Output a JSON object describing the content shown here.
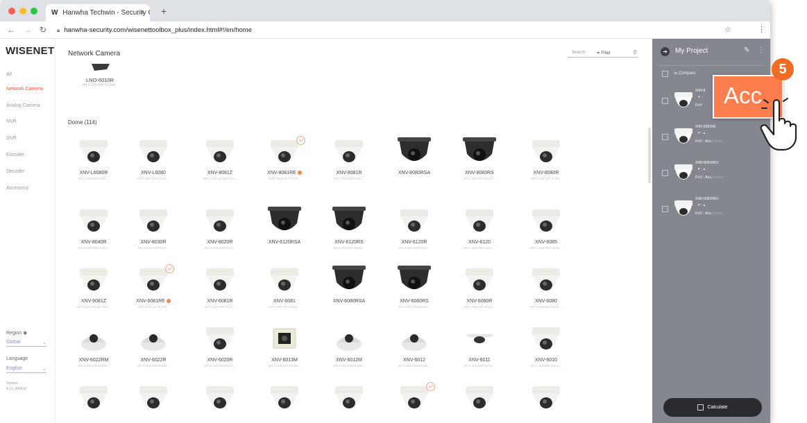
{
  "browser": {
    "tab_title": "Hanwha Techwin - Security Gi",
    "tab_favicon": "W",
    "url": "hanwha-security.com/wisenettoolbox_plus/index.html#!/en/home"
  },
  "sidebar": {
    "logo": "WISENET",
    "items": [
      {
        "label": "All"
      },
      {
        "label": "Network Camera"
      },
      {
        "label": "Analog Camera"
      },
      {
        "label": "NVR"
      },
      {
        "label": "DVR"
      },
      {
        "label": "Encoder"
      },
      {
        "label": "Decoder"
      },
      {
        "label": "Accessory"
      }
    ],
    "region_label": "Region",
    "region_value": "Global",
    "language_label": "Language",
    "language_value": "English",
    "version_label": "Version",
    "version_value": "4.13_200512"
  },
  "main": {
    "title": "Network Camera",
    "filter_label": "Filter",
    "search_placeholder": "Search",
    "top_product": {
      "name": "LNO-6010R",
      "desc": "2M H.264 NW IR Bull..."
    },
    "section_title": "Dome (114)",
    "products": [
      {
        "name": "XNV-L6080R",
        "desc": "2M H.265 NW IR Do...",
        "style": "white"
      },
      {
        "name": "XNV-L6080",
        "desc": "2M H.265 NW Dome ...",
        "style": "white"
      },
      {
        "name": "XNV-8081Z",
        "desc": "5M H.265 Vandal-Resi...",
        "style": "white"
      },
      {
        "name": "XNV-8081RE",
        "desc": "5MP Network IR Poll...",
        "style": "white",
        "badge": true,
        "checked": true
      },
      {
        "name": "XNV-8081R",
        "desc": "5M H.265 NW IR Do...",
        "style": "white"
      },
      {
        "name": "XNV-8080RSA",
        "desc": "",
        "style": "black"
      },
      {
        "name": "XNV-8080RS",
        "desc": "5M H.265 NW Stainle...",
        "style": "black"
      },
      {
        "name": "XNV-8080R",
        "desc": "5M H.265 NW IR Do...",
        "style": "white"
      },
      {
        "name": "XNV-8040R",
        "desc": "5M H.265 NW IR Do...",
        "style": "white"
      },
      {
        "name": "XNV-8030R",
        "desc": "5M H.265 NW IR Do...",
        "style": "white"
      },
      {
        "name": "XNV-8020R",
        "desc": "5M H.265 NW IR Do...",
        "style": "white"
      },
      {
        "name": "XNV-6120RSA",
        "desc": "",
        "style": "black"
      },
      {
        "name": "XNV-6120RS",
        "desc": "2M H.265 NW Stainle...",
        "style": "black"
      },
      {
        "name": "XNV-6120R",
        "desc": "2M H.265 NW IR Do...",
        "style": "white"
      },
      {
        "name": "XNV-6120",
        "desc": "2M H.265 NW Dome ...",
        "style": "white"
      },
      {
        "name": "XNV-6085",
        "desc": "2M H.265 NW Camer...",
        "style": "white"
      },
      {
        "name": "XNV-6081Z",
        "desc": "2M H.265 Vandal-Resi...",
        "style": "white"
      },
      {
        "name": "XNV-6081RE",
        "desc": "2MP Network IR Poll...",
        "style": "white",
        "badge": true,
        "checked": true
      },
      {
        "name": "XNV-6081R",
        "desc": "2M H.265 NW IR Do...",
        "style": "white"
      },
      {
        "name": "XNV-6081",
        "desc": "2M H.265 NW Dome ...",
        "style": "white"
      },
      {
        "name": "XNV-6080RSA",
        "desc": "",
        "style": "black"
      },
      {
        "name": "XNV-6080RS",
        "desc": "2M H.265 NW Stainle...",
        "style": "black"
      },
      {
        "name": "XNV-6080R",
        "desc": "2M H.265 NW IR Do...",
        "style": "white"
      },
      {
        "name": "XNV-6080",
        "desc": "2M H.265 NW Dome ...",
        "style": "white"
      },
      {
        "name": "XNV-6022RM",
        "desc": "2M H.265 NW Mobile...",
        "style": "flat"
      },
      {
        "name": "XNV-6022R",
        "desc": "2M H.265 NW Mobile...",
        "style": "flat"
      },
      {
        "name": "XNV-6020R",
        "desc": "2M H.265 NW IR Do...",
        "style": "white"
      },
      {
        "name": "XNV-6013M",
        "desc": "2M H.265 NW Mobile...",
        "style": "box"
      },
      {
        "name": "XNV-6012M",
        "desc": "2M H.265 NW Mobile...",
        "style": "flat"
      },
      {
        "name": "XNV-6012",
        "desc": "2M H.265 NW Mobile...",
        "style": "flat"
      },
      {
        "name": "XNV-6011",
        "desc": "2M H.265 NW Dome ...",
        "style": "mini"
      },
      {
        "name": "XNV-6010",
        "desc": "2M H.265 NW Dome ...",
        "style": "white"
      },
      {
        "name": "",
        "desc": "",
        "style": "white"
      },
      {
        "name": "",
        "desc": "",
        "style": "white"
      },
      {
        "name": "",
        "desc": "",
        "style": "white"
      },
      {
        "name": "",
        "desc": "",
        "style": "white"
      },
      {
        "name": "",
        "desc": "",
        "style": "white"
      },
      {
        "name": "",
        "desc": "",
        "style": "white",
        "checked": true
      },
      {
        "name": "",
        "desc": "",
        "style": "white"
      },
      {
        "name": "",
        "desc": "",
        "style": "white"
      }
    ]
  },
  "project": {
    "title": "My Project",
    "compare_label": "Compare",
    "items": [
      {
        "name": "XNV-8",
        "arrows": "▾  ↑",
        "fov": "FoV",
        "acc": "",
        "lens": ""
      },
      {
        "name": "XNV-6081RE",
        "arrows": "▾  ↑  ▴",
        "fov": "FoV",
        "acc": "Acc",
        "lens": "Lens"
      },
      {
        "name": "XND-8081REV",
        "arrows": "▾  ↑  ▴",
        "fov": "FoV",
        "acc": "Acc",
        "lens": "Lens"
      },
      {
        "name": "XND-6081REV",
        "arrows": "▾  ↑  ▴",
        "fov": "FoV",
        "acc": "Acc",
        "lens": "Lens"
      }
    ],
    "calculate_label": "Calculate"
  },
  "callout": {
    "text": "Acc",
    "step": "5"
  },
  "colors": {
    "accent": "#e85c3f",
    "panel": "#85878e",
    "callout": "#fd7e4d",
    "step": "#f26b22"
  }
}
